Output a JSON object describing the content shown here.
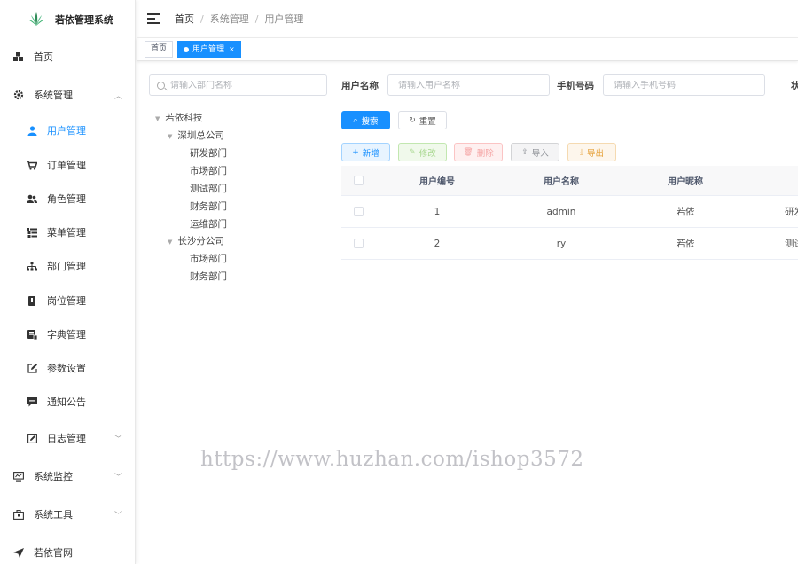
{
  "app": {
    "title": "若依管理系统"
  },
  "sidebar": {
    "items": [
      {
        "label": "首页",
        "icon": "dashboard-icon",
        "level": "top"
      },
      {
        "label": "系统管理",
        "icon": "gear-icon",
        "level": "top",
        "expanded": true
      },
      {
        "label": "用户管理",
        "icon": "user-icon",
        "level": "sub",
        "active": true
      },
      {
        "label": "订单管理",
        "icon": "cart-icon",
        "level": "sub"
      },
      {
        "label": "角色管理",
        "icon": "peoples-icon",
        "level": "sub"
      },
      {
        "label": "菜单管理",
        "icon": "tree-table-icon",
        "level": "sub"
      },
      {
        "label": "部门管理",
        "icon": "tree-icon",
        "level": "sub"
      },
      {
        "label": "岗位管理",
        "icon": "post-icon",
        "level": "sub"
      },
      {
        "label": "字典管理",
        "icon": "dict-icon",
        "level": "sub"
      },
      {
        "label": "参数设置",
        "icon": "edit-icon",
        "level": "sub"
      },
      {
        "label": "通知公告",
        "icon": "message-icon",
        "level": "sub"
      },
      {
        "label": "日志管理",
        "icon": "log-icon",
        "level": "sub"
      },
      {
        "label": "系统监控",
        "icon": "monitor-icon",
        "level": "top"
      },
      {
        "label": "系统工具",
        "icon": "tool-icon",
        "level": "top"
      },
      {
        "label": "若依官网",
        "icon": "guide-icon",
        "level": "top"
      }
    ]
  },
  "breadcrumb": [
    "首页",
    "系统管理",
    "用户管理"
  ],
  "tags": [
    {
      "label": "首页"
    },
    {
      "label": "用户管理",
      "active": true,
      "close": "×"
    }
  ],
  "dept": {
    "search_placeholder": "请输入部门名称",
    "tree": {
      "root": "若依科技",
      "shenzhen": "深圳总公司",
      "sz_children": [
        "研发部门",
        "市场部门",
        "测试部门",
        "财务部门",
        "运维部门"
      ],
      "changsha": "长沙分公司",
      "cs_children": [
        "市场部门",
        "财务部门"
      ]
    }
  },
  "filters": {
    "username_label": "用户名称",
    "username_placeholder": "请输入用户名称",
    "phone_label": "手机号码",
    "phone_placeholder": "请输入手机号码",
    "status_label_partial": "状"
  },
  "actions": {
    "search": "搜索",
    "reset": "重置",
    "add": "新增",
    "edit": "修改",
    "delete": "删除",
    "import": "导入",
    "export": "导出"
  },
  "table": {
    "columns": [
      "用户编号",
      "用户名称",
      "用户昵称"
    ],
    "rows": [
      {
        "id": "1",
        "username": "admin",
        "nickname": "若依",
        "dept_partial": "研发"
      },
      {
        "id": "2",
        "username": "ry",
        "nickname": "若依",
        "dept_partial": "测试"
      }
    ]
  },
  "watermark": "https://www.huzhan.com/ishop3572",
  "colors": {
    "primary": "#1890ff",
    "success": "#67c23a",
    "danger": "#f56c6c",
    "warning": "#e6a23c"
  }
}
